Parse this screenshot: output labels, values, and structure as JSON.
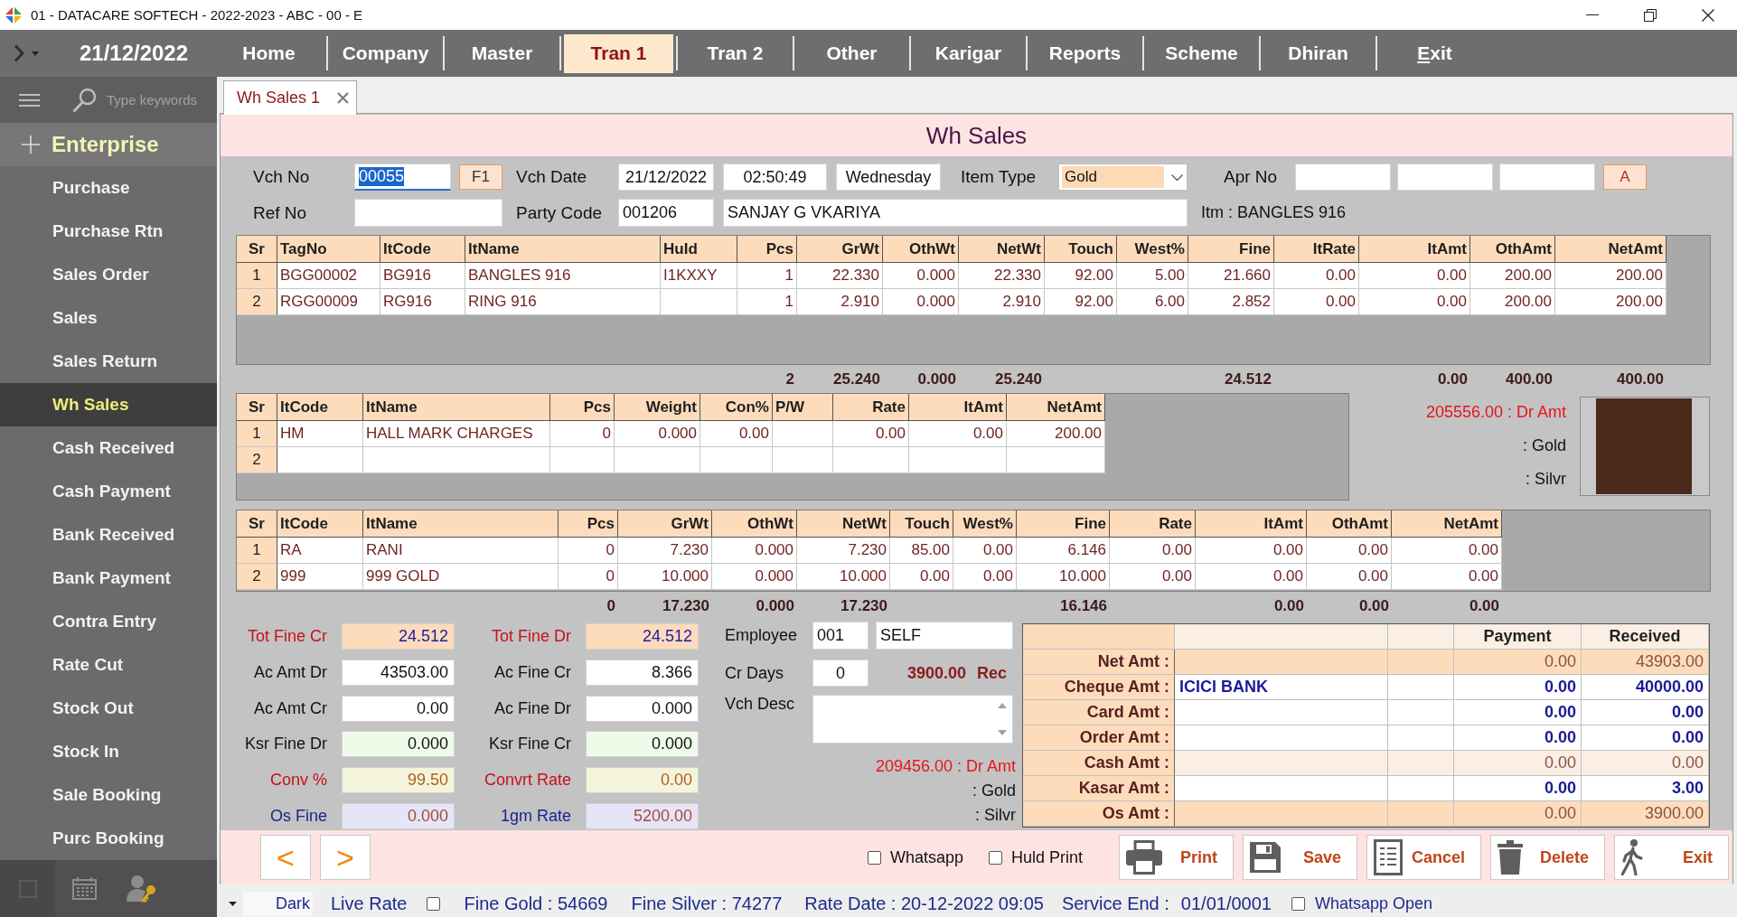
{
  "window": {
    "title": "01 - DATACARE SOFTECH - 2022-2023 - ABC - 00 - E"
  },
  "menu_bar": {
    "date": "21/12/2022",
    "items": [
      {
        "label": "Home",
        "selected": false,
        "mnemonic": false
      },
      {
        "label": "Company",
        "selected": false,
        "mnemonic": false
      },
      {
        "label": "Master",
        "selected": false,
        "mnemonic": false
      },
      {
        "label": "Tran 1",
        "selected": true,
        "mnemonic": false
      },
      {
        "label": "Tran 2",
        "selected": false,
        "mnemonic": false
      },
      {
        "label": "Other",
        "selected": false,
        "mnemonic": false
      },
      {
        "label": "Karigar",
        "selected": false,
        "mnemonic": false
      },
      {
        "label": "Reports",
        "selected": false,
        "mnemonic": false
      },
      {
        "label": "Scheme",
        "selected": false,
        "mnemonic": false
      },
      {
        "label": "Dhiran",
        "selected": false,
        "mnemonic": false
      },
      {
        "label": "Exit",
        "selected": false,
        "mnemonic": true
      }
    ]
  },
  "sidebar": {
    "search": {
      "placeholder": "Type keywords"
    },
    "section": "Enterprise",
    "items": [
      {
        "label": "Purchase",
        "selected": false
      },
      {
        "label": "Purchase Rtn",
        "selected": false
      },
      {
        "label": "Sales Order",
        "selected": false
      },
      {
        "label": "Sales",
        "selected": false
      },
      {
        "label": "Sales Return",
        "selected": false
      },
      {
        "label": "Wh Sales",
        "selected": true
      },
      {
        "label": "Cash Received",
        "selected": false
      },
      {
        "label": "Cash Payment",
        "selected": false
      },
      {
        "label": "Bank Received",
        "selected": false
      },
      {
        "label": "Bank Payment",
        "selected": false
      },
      {
        "label": "Contra Entry",
        "selected": false
      },
      {
        "label": "Rate Cut",
        "selected": false
      },
      {
        "label": "Stock Out",
        "selected": false
      },
      {
        "label": "Stock In",
        "selected": false
      },
      {
        "label": "Sale Booking",
        "selected": false
      },
      {
        "label": "Purc Booking",
        "selected": false
      }
    ]
  },
  "tabs": [
    {
      "label": "Wh Sales 1",
      "selected": true
    }
  ],
  "form": {
    "title": "Wh Sales",
    "header": {
      "vch_no": {
        "label": "Vch No",
        "value": "00055",
        "highlighted": true
      },
      "f1_button": "F1",
      "vch_date": {
        "label": "Vch Date",
        "date": "21/12/2022",
        "time": "02:50:49",
        "day": "Wednesday"
      },
      "item_type": {
        "label": "Item Type",
        "value": "Gold"
      },
      "apr_no": {
        "label": "Apr No"
      },
      "a_button": "A",
      "ref_no": {
        "label": "Ref No"
      },
      "party": {
        "label": "Party Code",
        "code": "001206",
        "name": "SANJAY G VKARIYA"
      },
      "item_info": "Itm : BANGLES 916"
    },
    "items_grid": {
      "columns": [
        {
          "label": "Sr",
          "kind": "serial"
        },
        {
          "label": "TagNo",
          "kind": "text"
        },
        {
          "label": "ItCode",
          "kind": "text"
        },
        {
          "label": "ItName",
          "kind": "text"
        },
        {
          "label": "HuId",
          "kind": "text"
        },
        {
          "label": "Pcs",
          "kind": "number"
        },
        {
          "label": "GrWt",
          "kind": "number"
        },
        {
          "label": "OthWt",
          "kind": "number"
        },
        {
          "label": "NetWt",
          "kind": "number"
        },
        {
          "label": "Touch",
          "kind": "number"
        },
        {
          "label": "West%",
          "kind": "number"
        },
        {
          "label": "Fine",
          "kind": "number"
        },
        {
          "label": "ItRate",
          "kind": "number"
        },
        {
          "label": "ItAmt",
          "kind": "number"
        },
        {
          "label": "OthAmt",
          "kind": "number"
        },
        {
          "label": "NetAmt",
          "kind": "number"
        }
      ],
      "rows": [
        [
          "1",
          "BGG00002",
          "BG916",
          "BANGLES 916",
          "I1KXXY",
          "1",
          "22.330",
          "0.000",
          "22.330",
          "92.00",
          "5.00",
          "21.660",
          "0.00",
          "0.00",
          "200.00",
          "200.00"
        ],
        [
          "2",
          "RGG00009",
          "RG916",
          "RING 916",
          null,
          "1",
          "2.910",
          "0.000",
          "2.910",
          "92.00",
          "6.00",
          "2.852",
          "0.00",
          "0.00",
          "200.00",
          "200.00"
        ]
      ]
    },
    "items_totals": {
      "rows": [
        [
          null,
          null,
          null,
          null,
          null,
          "2",
          "25.240",
          "0.000",
          "25.240",
          null,
          null,
          "24.512",
          null,
          "0.00",
          "400.00",
          "400.00"
        ]
      ]
    },
    "charges_grid": {
      "columns": [
        {
          "label": "Sr",
          "kind": "serial"
        },
        {
          "label": "ItCode",
          "kind": "text"
        },
        {
          "label": "ItName",
          "kind": "text"
        },
        {
          "label": "Pcs",
          "kind": "number"
        },
        {
          "label": "Weight",
          "kind": "number"
        },
        {
          "label": "Con%",
          "kind": "number"
        },
        {
          "label": "P/W",
          "kind": "text"
        },
        {
          "label": "Rate",
          "kind": "number"
        },
        {
          "label": "ItAmt",
          "kind": "number"
        },
        {
          "label": "NetAmt",
          "kind": "number"
        }
      ],
      "rows": [
        [
          "1",
          "HM",
          "HALL MARK CHARGES",
          "0",
          "0.000",
          "0.00",
          null,
          "0.00",
          "0.00",
          "200.00"
        ],
        [
          "2",
          null,
          null,
          null,
          null,
          null,
          null,
          null,
          null,
          null
        ]
      ]
    },
    "balance": {
      "dr_amt": "205556.00 : Dr Amt",
      "gold": ": Gold",
      "silver": ": Silvr"
    },
    "metal_grid": {
      "columns": [
        {
          "label": "Sr",
          "kind": "serial"
        },
        {
          "label": "ItCode",
          "kind": "text"
        },
        {
          "label": "ItName",
          "kind": "text"
        },
        {
          "label": "Pcs",
          "kind": "number"
        },
        {
          "label": "GrWt",
          "kind": "number"
        },
        {
          "label": "OthWt",
          "kind": "number"
        },
        {
          "label": "NetWt",
          "kind": "number"
        },
        {
          "label": "Touch",
          "kind": "number"
        },
        {
          "label": "West%",
          "kind": "number"
        },
        {
          "label": "Fine",
          "kind": "number"
        },
        {
          "label": "Rate",
          "kind": "number"
        },
        {
          "label": "ItAmt",
          "kind": "number"
        },
        {
          "label": "OthAmt",
          "kind": "number"
        },
        {
          "label": "NetAmt",
          "kind": "number"
        }
      ],
      "rows": [
        [
          "1",
          "RA",
          "RANI",
          "0",
          "7.230",
          "0.000",
          "7.230",
          "85.00",
          "0.00",
          "6.146",
          "0.00",
          "0.00",
          "0.00",
          "0.00"
        ],
        [
          "2",
          "999",
          "999 GOLD",
          "0",
          "10.000",
          "0.000",
          "10.000",
          "0.00",
          "0.00",
          "10.000",
          "0.00",
          "0.00",
          "0.00",
          "0.00"
        ]
      ]
    },
    "metal_totals": {
      "rows": [
        [
          null,
          null,
          null,
          "0",
          "17.230",
          "0.000",
          "17.230",
          null,
          null,
          "16.146",
          null,
          "0.00",
          "0.00",
          "0.00"
        ]
      ]
    },
    "summary_fields": [
      {
        "label": "Tot Fine Cr",
        "value": "24.512",
        "kind": "total"
      },
      {
        "label": "Tot Fine Dr",
        "value": "24.512",
        "kind": "total"
      },
      {
        "label": "Ac Amt Dr",
        "value": "43503.00",
        "kind": "plain"
      },
      {
        "label": "Ac Fine Cr",
        "value": "8.366",
        "kind": "plain"
      },
      {
        "label": "Ac Amt Cr",
        "value": "0.00",
        "kind": "plain"
      },
      {
        "label": "Ac Fine Dr",
        "value": "0.000",
        "kind": "plain"
      },
      {
        "label": "Ksr Fine Dr",
        "value": "0.000",
        "kind": "kasar"
      },
      {
        "label": "Ksr Fine Cr",
        "value": "0.000",
        "kind": "kasar"
      },
      {
        "label": "Conv %",
        "value": "99.50",
        "kind": "conversion"
      },
      {
        "label": "Convrt Rate",
        "value": "0.00",
        "kind": "conversion"
      },
      {
        "label": "Os Fine",
        "value": "0.000",
        "kind": "rate"
      },
      {
        "label": "1gm Rate",
        "value": "5200.00",
        "kind": "rate"
      }
    ],
    "employee": {
      "label": "Employee",
      "code": "001",
      "name": "SELF"
    },
    "cr_days": {
      "label": "Cr Days",
      "value": "0",
      "amount": "3900.00",
      "amount_type": "Rec"
    },
    "vch_desc": {
      "label": "Vch Desc"
    },
    "outstanding": {
      "dr_amt": "209456.00 : Dr Amt",
      "gold": ": Gold",
      "silver": ": Silvr"
    },
    "payment_table": {
      "columns": [
        "Payment",
        "Received"
      ],
      "rows": [
        {
          "label": "Net Amt :",
          "payment": "0.00",
          "received": "43903.00",
          "kind": "total"
        },
        {
          "label": "Cheque Amt :",
          "bank": "ICICI BANK",
          "payment": "0.00",
          "received": "40000.00",
          "kind": "input"
        },
        {
          "label": "Card Amt :",
          "payment": "0.00",
          "received": "0.00",
          "kind": "input"
        },
        {
          "label": "Order Amt :",
          "payment": "0.00",
          "received": "0.00",
          "kind": "input"
        },
        {
          "label": "Cash Amt :",
          "payment": "0.00",
          "received": "0.00",
          "kind": "computed"
        },
        {
          "label": "Kasar Amt :",
          "payment": "0.00",
          "received": "3.00",
          "kind": "input"
        },
        {
          "label": "Os Amt :",
          "payment": "0.00",
          "received": "3900.00",
          "kind": "total"
        }
      ]
    },
    "button_bar": {
      "nav": [
        "<",
        ">"
      ],
      "checkboxes": [
        {
          "label": "Whatsapp",
          "checked": false
        },
        {
          "label": "Huld Print",
          "checked": false
        }
      ],
      "actions": [
        {
          "label": "Print",
          "kind": "print"
        },
        {
          "label": "Save",
          "kind": "save"
        },
        {
          "label": "Cancel",
          "kind": "cancel"
        },
        {
          "label": "Delete",
          "kind": "delete"
        },
        {
          "label": "Exit",
          "kind": "exit"
        }
      ]
    }
  },
  "status_bar": {
    "theme": "Dark",
    "live_rate": {
      "label": "Live Rate",
      "checked": false
    },
    "fine_gold": "Fine Gold : 54669",
    "fine_silver": "Fine Silver : 74277",
    "rate_date": "Rate Date : 20-12-2022 09:05",
    "service_end": {
      "label": "Service End :",
      "value": "01/01/0001"
    },
    "whatsapp_open": {
      "label": "Whatsapp Open",
      "checked": false
    }
  }
}
